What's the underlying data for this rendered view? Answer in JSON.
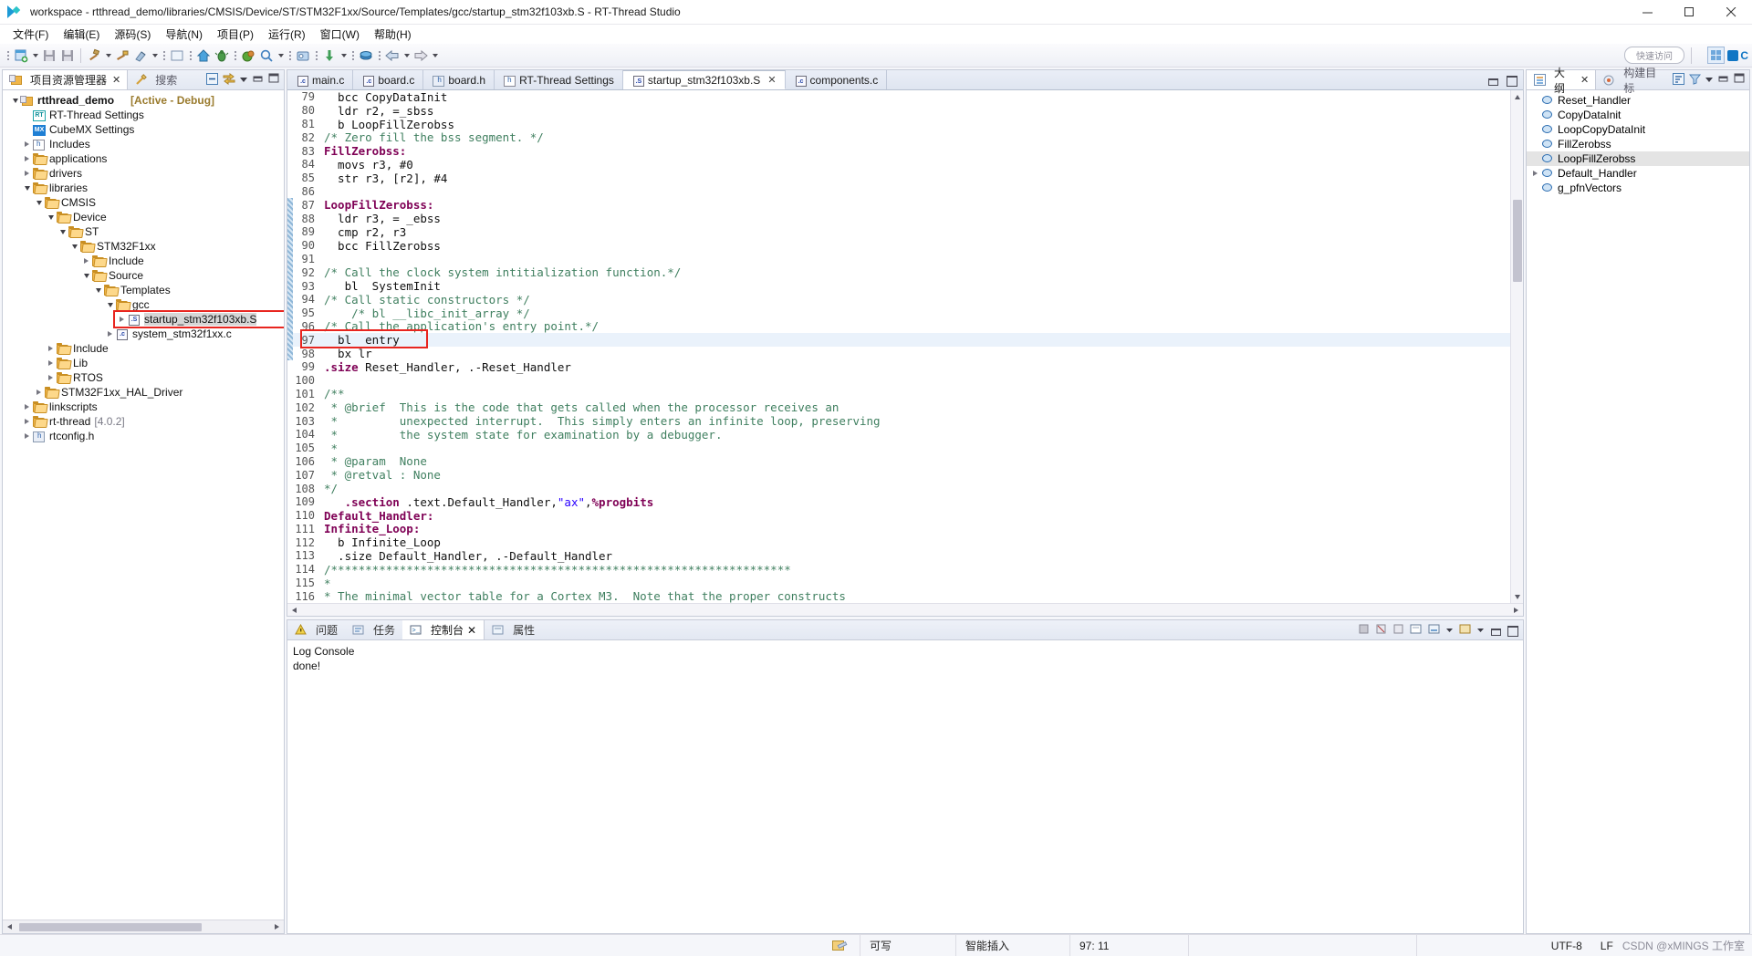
{
  "window": {
    "title": "workspace - rtthread_demo/libraries/CMSIS/Device/ST/STM32F1xx/Source/Templates/gcc/startup_stm32f103xb.S - RT-Thread Studio",
    "minimize_label": "Minimize",
    "maximize_label": "Maximize",
    "close_label": "Close"
  },
  "menu": {
    "items": [
      {
        "label": "文件(F)"
      },
      {
        "label": "编辑(E)"
      },
      {
        "label": "源码(S)"
      },
      {
        "label": "导航(N)"
      },
      {
        "label": "项目(P)"
      },
      {
        "label": "运行(R)"
      },
      {
        "label": "窗口(W)"
      },
      {
        "label": "帮助(H)"
      }
    ]
  },
  "toolbar": {
    "quick_access": "快速访问",
    "perspective_c_label": "C",
    "buttons": [
      "new-project-icon",
      "save-icon",
      "save-all-icon",
      "build-hammer-icon",
      "build-target-icon",
      "clean-icon",
      "terminal-icon",
      "home-icon",
      "bug-icon",
      "run-icon",
      "search-icon",
      "flash-download-icon",
      "download-icon",
      "rtthread-icon",
      "back-icon",
      "forward-icon"
    ]
  },
  "project_explorer": {
    "tab_label": "项目资源管理器",
    "search_tab_label": "搜索",
    "tree": [
      {
        "indent": 0,
        "expander": "down",
        "icon": "project-icon",
        "label": "rtthread_demo",
        "bold": true,
        "suffix": "[Active - Debug]",
        "suffix_style": "active"
      },
      {
        "indent": 1,
        "expander": "none",
        "icon": "rt-settings-icon",
        "label": "RT-Thread Settings"
      },
      {
        "indent": 1,
        "expander": "none",
        "icon": "cubemx-icon",
        "label": "CubeMX Settings"
      },
      {
        "indent": 1,
        "expander": "right",
        "icon": "includes-icon",
        "label": "Includes"
      },
      {
        "indent": 1,
        "expander": "right",
        "icon": "folder-icon",
        "label": "applications"
      },
      {
        "indent": 1,
        "expander": "right",
        "icon": "folder-icon",
        "label": "drivers"
      },
      {
        "indent": 1,
        "expander": "down",
        "icon": "folder-icon",
        "label": "libraries"
      },
      {
        "indent": 2,
        "expander": "down",
        "icon": "folder-icon",
        "label": "CMSIS"
      },
      {
        "indent": 3,
        "expander": "down",
        "icon": "folder-icon",
        "label": "Device"
      },
      {
        "indent": 4,
        "expander": "down",
        "icon": "folder-icon",
        "label": "ST"
      },
      {
        "indent": 5,
        "expander": "down",
        "icon": "folder-icon",
        "label": "STM32F1xx"
      },
      {
        "indent": 6,
        "expander": "right",
        "icon": "folder-icon",
        "label": "Include"
      },
      {
        "indent": 6,
        "expander": "down",
        "icon": "folder-icon",
        "label": "Source"
      },
      {
        "indent": 7,
        "expander": "down",
        "icon": "folder-icon",
        "label": "Templates"
      },
      {
        "indent": 8,
        "expander": "down",
        "icon": "folder-icon",
        "label": "gcc"
      },
      {
        "indent": 9,
        "expander": "right",
        "icon": "asm-file-icon",
        "label": "startup_stm32f103xb.S",
        "selected": true,
        "highlight": true
      },
      {
        "indent": 8,
        "expander": "right",
        "icon": "c-file-icon",
        "label": "system_stm32f1xx.c"
      },
      {
        "indent": 3,
        "expander": "right",
        "icon": "folder-icon",
        "label": "Include"
      },
      {
        "indent": 3,
        "expander": "right",
        "icon": "folder-icon",
        "label": "Lib"
      },
      {
        "indent": 3,
        "expander": "right",
        "icon": "folder-icon",
        "label": "RTOS"
      },
      {
        "indent": 2,
        "expander": "right",
        "icon": "folder-icon",
        "label": "STM32F1xx_HAL_Driver"
      },
      {
        "indent": 1,
        "expander": "right",
        "icon": "folder-icon",
        "label": "linkscripts"
      },
      {
        "indent": 1,
        "expander": "right",
        "icon": "folder-icon",
        "label": "rt-thread",
        "suffix": "[4.0.2]"
      },
      {
        "indent": 1,
        "expander": "right",
        "icon": "h-file-icon",
        "label": "rtconfig.h"
      }
    ]
  },
  "editor": {
    "tabs": [
      {
        "label": "main.c",
        "icon": "c-file-icon",
        "active": false
      },
      {
        "label": "board.c",
        "icon": "c-file-icon",
        "active": false
      },
      {
        "label": "board.h",
        "icon": "h-file-icon",
        "active": false
      },
      {
        "label": "RT-Thread Settings",
        "icon": "settings-icon",
        "active": false
      },
      {
        "label": "startup_stm32f103xb.S",
        "icon": "asm-file-icon",
        "active": true,
        "closable": true
      },
      {
        "label": "components.c",
        "icon": "c-file-icon",
        "active": false
      }
    ],
    "first_line": 79,
    "lines": [
      {
        "n": 79,
        "segs": [
          {
            "t": "  bcc CopyDataInit",
            "c": "plain"
          }
        ]
      },
      {
        "n": 80,
        "segs": [
          {
            "t": "  ldr r2, =_sbss",
            "c": "plain"
          }
        ]
      },
      {
        "n": 81,
        "segs": [
          {
            "t": "  b LoopFillZerobss",
            "c": "plain"
          }
        ]
      },
      {
        "n": 82,
        "segs": [
          {
            "t": "/* Zero fill the bss segment. */",
            "c": "cmt"
          }
        ]
      },
      {
        "n": 83,
        "segs": [
          {
            "t": "FillZerobss:",
            "c": "kw"
          }
        ]
      },
      {
        "n": 84,
        "segs": [
          {
            "t": "  movs r3, #0",
            "c": "plain"
          }
        ]
      },
      {
        "n": 85,
        "segs": [
          {
            "t": "  str r3, [r2], #4",
            "c": "plain"
          }
        ]
      },
      {
        "n": 86,
        "segs": [
          {
            "t": "",
            "c": "plain"
          }
        ]
      },
      {
        "n": 87,
        "segs": [
          {
            "t": "LoopFillZerobss:",
            "c": "kw"
          }
        ],
        "changed": true
      },
      {
        "n": 88,
        "segs": [
          {
            "t": "  ldr r3, = _ebss",
            "c": "plain"
          }
        ],
        "changed": true
      },
      {
        "n": 89,
        "segs": [
          {
            "t": "  cmp r2, r3",
            "c": "plain"
          }
        ],
        "changed": true
      },
      {
        "n": 90,
        "segs": [
          {
            "t": "  bcc FillZerobss",
            "c": "plain"
          }
        ],
        "changed": true
      },
      {
        "n": 91,
        "segs": [
          {
            "t": "",
            "c": "plain"
          }
        ],
        "changed": true
      },
      {
        "n": 92,
        "segs": [
          {
            "t": "/* Call the clock system intitialization function.*/",
            "c": "cmt"
          }
        ],
        "changed": true
      },
      {
        "n": 93,
        "segs": [
          {
            "t": "   bl  SystemInit",
            "c": "plain"
          }
        ],
        "changed": true
      },
      {
        "n": 94,
        "segs": [
          {
            "t": "/* Call static constructors */",
            "c": "cmt"
          }
        ],
        "changed": true
      },
      {
        "n": 95,
        "segs": [
          {
            "t": "    /* bl __libc_init_array */",
            "c": "cmt"
          }
        ],
        "changed": true
      },
      {
        "n": 96,
        "segs": [
          {
            "t": "/* Call the application's entry point.*/",
            "c": "cmt"
          }
        ],
        "changed": true
      },
      {
        "n": 97,
        "segs": [
          {
            "t": "  bl  entry",
            "c": "plain"
          }
        ],
        "changed": true,
        "highlight": true,
        "redbox": true
      },
      {
        "n": 98,
        "segs": [
          {
            "t": "  bx lr",
            "c": "plain"
          }
        ],
        "changed": true
      },
      {
        "n": 99,
        "segs": [
          {
            "t": ".size",
            "c": "dir"
          },
          {
            "t": " Reset_Handler, .-Reset_Handler",
            "c": "plain"
          }
        ]
      },
      {
        "n": 100,
        "segs": [
          {
            "t": "",
            "c": "plain"
          }
        ]
      },
      {
        "n": 101,
        "segs": [
          {
            "t": "/**",
            "c": "cmt"
          }
        ]
      },
      {
        "n": 102,
        "segs": [
          {
            "t": " * @brief  This is the code that gets called when the processor receives an",
            "c": "cmt"
          }
        ]
      },
      {
        "n": 103,
        "segs": [
          {
            "t": " *         unexpected interrupt.  This simply enters an infinite loop, preserving",
            "c": "cmt"
          }
        ]
      },
      {
        "n": 104,
        "segs": [
          {
            "t": " *         the system state for examination by a debugger.",
            "c": "cmt"
          }
        ]
      },
      {
        "n": 105,
        "segs": [
          {
            "t": " *",
            "c": "cmt"
          }
        ]
      },
      {
        "n": 106,
        "segs": [
          {
            "t": " * @param  None",
            "c": "cmt"
          }
        ]
      },
      {
        "n": 107,
        "segs": [
          {
            "t": " * @retval : None",
            "c": "cmt"
          }
        ]
      },
      {
        "n": 108,
        "segs": [
          {
            "t": "*/",
            "c": "cmt"
          }
        ]
      },
      {
        "n": 109,
        "segs": [
          {
            "t": "   ",
            "c": "plain"
          },
          {
            "t": ".section",
            "c": "dir"
          },
          {
            "t": " .text.Default_Handler,",
            "c": "plain"
          },
          {
            "t": "\"ax\"",
            "c": "str"
          },
          {
            "t": ",",
            "c": "plain"
          },
          {
            "t": "%progbits",
            "c": "mac"
          }
        ]
      },
      {
        "n": 110,
        "segs": [
          {
            "t": "Default_Handler:",
            "c": "kw"
          }
        ]
      },
      {
        "n": 111,
        "segs": [
          {
            "t": "Infinite_Loop:",
            "c": "kw"
          }
        ]
      },
      {
        "n": 112,
        "segs": [
          {
            "t": "  b Infinite_Loop",
            "c": "plain"
          }
        ]
      },
      {
        "n": 113,
        "segs": [
          {
            "t": "  .size Default_Handler, .-Default_Handler",
            "c": "plain"
          }
        ]
      },
      {
        "n": 114,
        "segs": [
          {
            "t": "/*******************************************************************",
            "c": "cmt"
          }
        ]
      },
      {
        "n": 115,
        "segs": [
          {
            "t": "*",
            "c": "cmt"
          }
        ]
      },
      {
        "n": 116,
        "segs": [
          {
            "t": "* The minimal vector table for a Cortex M3.  Note that the proper constructs",
            "c": "cmt"
          }
        ]
      }
    ]
  },
  "console": {
    "tabs": [
      {
        "label": "问题",
        "icon": "problems-icon",
        "active": false
      },
      {
        "label": "任务",
        "icon": "tasks-icon",
        "active": false
      },
      {
        "label": "控制台",
        "icon": "console-icon",
        "active": true,
        "closable": true
      },
      {
        "label": "属性",
        "icon": "properties-icon",
        "active": false
      }
    ],
    "title": "Log Console",
    "output": [
      "done!"
    ]
  },
  "outline": {
    "tab_label": "大纲",
    "build_targets_tab_label": "构建目标",
    "items": [
      {
        "label": "Reset_Handler",
        "expander": "none",
        "selected": false
      },
      {
        "label": "CopyDataInit",
        "expander": "none",
        "selected": false
      },
      {
        "label": "LoopCopyDataInit",
        "expander": "none",
        "selected": false
      },
      {
        "label": "FillZerobss",
        "expander": "none",
        "selected": false
      },
      {
        "label": "LoopFillZerobss",
        "expander": "none",
        "selected": true
      },
      {
        "label": "Default_Handler",
        "expander": "right",
        "selected": false
      },
      {
        "label": "g_pfnVectors",
        "expander": "none",
        "selected": false
      }
    ]
  },
  "statusbar": {
    "writable": "可写",
    "insert_mode": "智能插入",
    "cursor_position": "97: 11",
    "encoding": "UTF-8",
    "line_ending": "LF",
    "watermark": "CSDN @xMINGS 工作室"
  }
}
